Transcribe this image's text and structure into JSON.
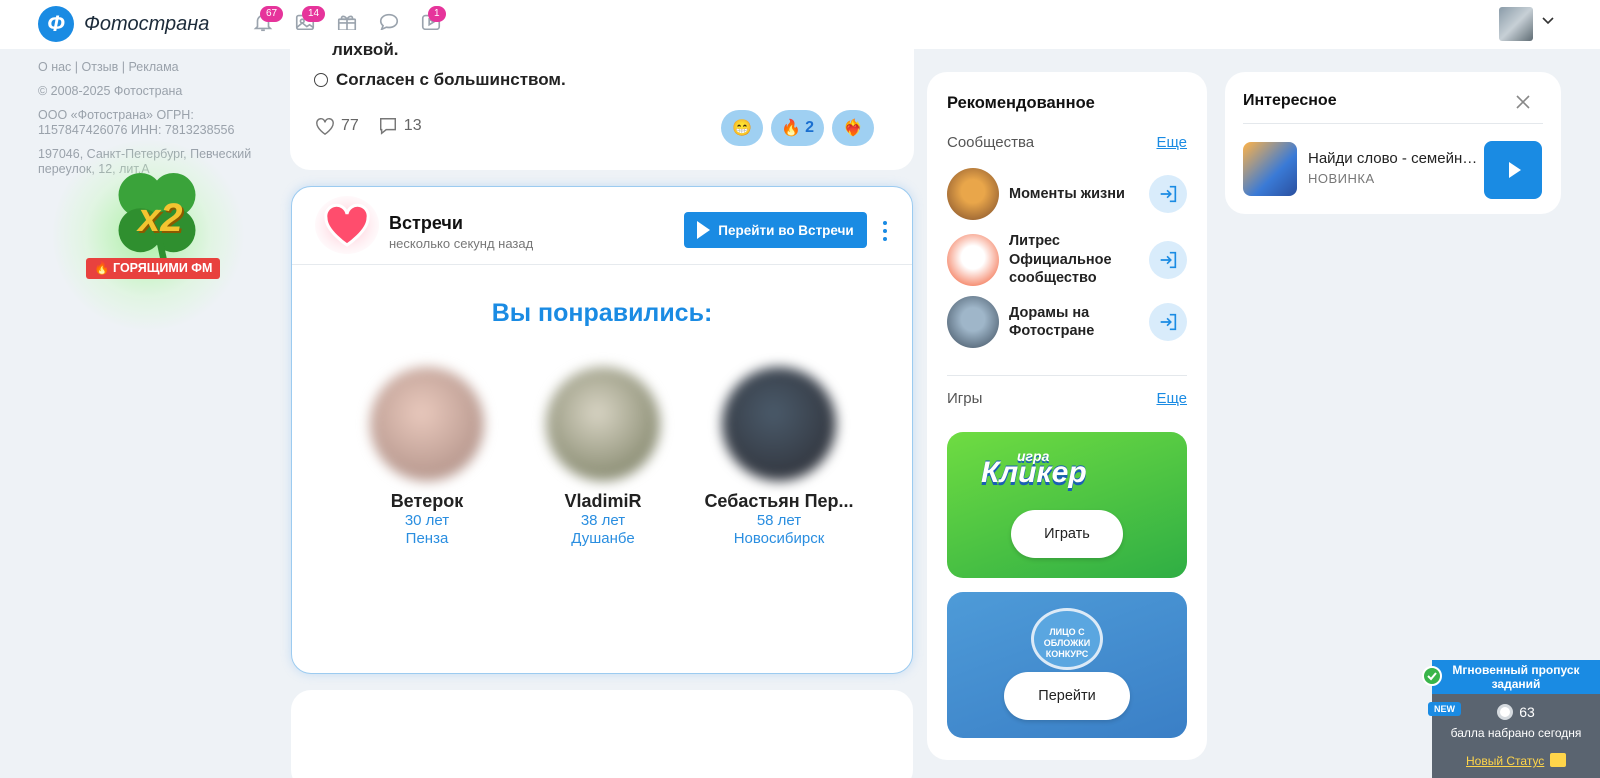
{
  "header": {
    "logo_letter": "Ф",
    "logo_text": "Фотострана",
    "badges": {
      "notifications": "67",
      "photos": "14",
      "videos": "1"
    }
  },
  "footer_info": {
    "links": "О нас | Отзыв | Реклама",
    "copyright": "© 2008-2025 Фотострана",
    "company": "ООО «Фотострана» ОГРН: 1157847426076 ИНН: 7813238556",
    "address": "197046, Санкт-Петербург, Певческий переулок, 12, лит.А"
  },
  "promo": {
    "multiplier": "x2",
    "label": "🔥 ГОРЯЩИМИ ФМ"
  },
  "poll": {
    "partial_text": "лихвой.",
    "option": "Согласен с большинством.",
    "likes": "77",
    "comments": "13",
    "reactions": [
      {
        "emoji": "😁",
        "count": ""
      },
      {
        "emoji": "🔥",
        "count": "2"
      },
      {
        "emoji": "❤️‍🔥",
        "count": ""
      }
    ]
  },
  "meetings": {
    "title": "Встречи",
    "time": "несколько секунд назад",
    "button": "Перейти во Встречи",
    "liked_heading": "Вы понравились:",
    "people": [
      {
        "name": "Ветерок",
        "age": "30 лет",
        "city": "Пенза",
        "photo_colors": [
          "#e9c9bd",
          "#a4857c"
        ]
      },
      {
        "name": "VladimiR",
        "age": "38 лет",
        "city": "Душанбе",
        "photo_colors": [
          "#d8d4c4",
          "#6e7356"
        ]
      },
      {
        "name": "Себастьян Пер...",
        "age": "58 лет",
        "city": "Новосибирск",
        "photo_colors": [
          "#4a5a6a",
          "#2a2a30"
        ]
      }
    ]
  },
  "recommended": {
    "title": "Рекомендованное",
    "communities_label": "Сообщества",
    "more": "Еще",
    "communities": [
      {
        "name": "Моменты жизни",
        "colors": [
          "#e9a64a",
          "#7a4a2a"
        ]
      },
      {
        "name": "Литрес Официальное сообщество",
        "colors": [
          "#ffffff",
          "#f04e23"
        ]
      },
      {
        "name": "Дорамы на Фотостране",
        "colors": [
          "#9fb6c9",
          "#3a4a5a"
        ]
      }
    ],
    "games_label": "Игры",
    "games_more": "Еще",
    "game1": {
      "subtitle": "игра",
      "logo": "Кликер",
      "button": "Играть"
    },
    "game2": {
      "seal": "ЛИЦО С ОБЛОЖКИ КОНКУРС",
      "button": "Перейти"
    }
  },
  "interesting": {
    "title": "Интересное",
    "item_name": "Найди слово - семейная игра",
    "item_sub": "НОВИНКА"
  },
  "widget": {
    "title": "Мгновенный пропуск заданий",
    "new_badge": "NEW",
    "points": "63",
    "points_label": "балла набрано сегодня",
    "link": "Новый Статус"
  },
  "colors": {
    "accent": "#1a8be3",
    "badge": "#e6349b",
    "page_bg": "#eef2f6"
  }
}
